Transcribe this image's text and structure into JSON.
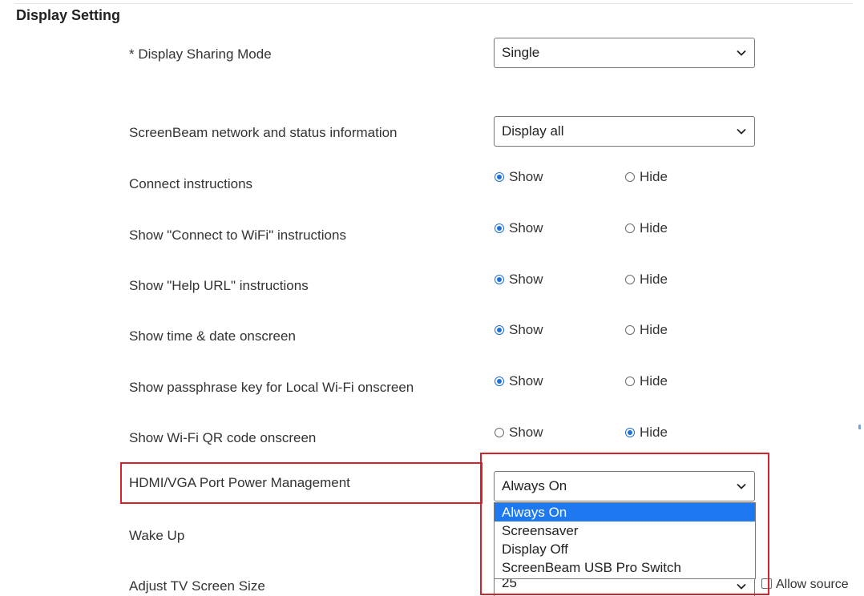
{
  "section": {
    "title": "Display Setting"
  },
  "rows": {
    "sharing_mode": {
      "label": "* Display Sharing Mode",
      "value": "Single"
    },
    "network_info": {
      "label": "ScreenBeam network and status information",
      "value": "Display all"
    },
    "connect_instructions": {
      "label": "Connect instructions",
      "show": "Show",
      "hide": "Hide",
      "selected": "Show"
    },
    "wifi_instructions": {
      "label": "Show \"Connect to WiFi\" instructions",
      "show": "Show",
      "hide": "Hide",
      "selected": "Show"
    },
    "help_url": {
      "label": "Show \"Help URL\" instructions",
      "show": "Show",
      "hide": "Hide",
      "selected": "Show"
    },
    "time_date": {
      "label": "Show time & date onscreen",
      "show": "Show",
      "hide": "Hide",
      "selected": "Show"
    },
    "passphrase": {
      "label": "Show passphrase key for Local Wi-Fi onscreen",
      "show": "Show",
      "hide": "Hide",
      "selected": "Show"
    },
    "qr_code": {
      "label": "Show Wi-Fi QR code onscreen",
      "show": "Show",
      "hide": "Hide",
      "selected": "Hide"
    },
    "port_power": {
      "label": "HDMI/VGA Port Power Management",
      "value": "Always On",
      "options": [
        "Always On",
        "Screensaver",
        "Display Off",
        "ScreenBeam USB Pro Switch"
      ],
      "highlighted_option": "Always On"
    },
    "wake_up": {
      "label": "Wake Up"
    },
    "tv_size": {
      "label": "Adjust TV Screen Size",
      "value": "25",
      "checkbox_label": "Allow source"
    }
  },
  "colors": {
    "accent": "#1f6fd6",
    "highlight_border": "#d2232a",
    "dropdown_active": "#1e78f0"
  },
  "icons": {
    "select_arrow": "chevron-down-icon"
  }
}
